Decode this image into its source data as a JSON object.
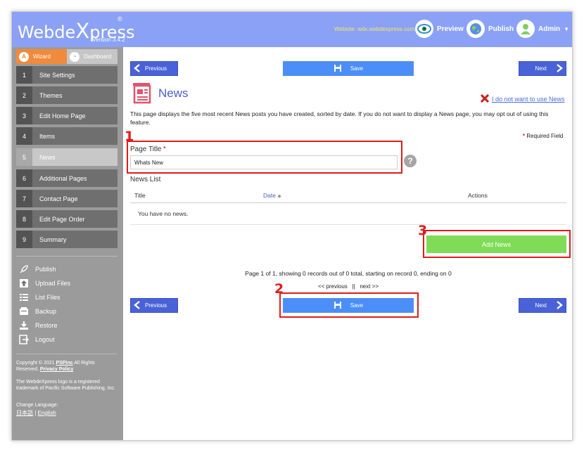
{
  "header": {
    "logo_part1": "Webde",
    "logo_x": "X",
    "logo_part2": "press",
    "logo_reg": "®",
    "version": "Version 3.4.2",
    "website": "Website: wdx.webdexpress.com",
    "preview": "Preview",
    "publish": "Publish",
    "admin": "Admin"
  },
  "sidebar": {
    "tab_wizard": "Wizard",
    "tab_dashboard": "Dashboard",
    "steps": [
      {
        "num": "1",
        "label": "Site Settings"
      },
      {
        "num": "2",
        "label": "Themes"
      },
      {
        "num": "3",
        "label": "Edit Home Page"
      },
      {
        "num": "4",
        "label": "Items"
      },
      {
        "num": "5",
        "label": "News"
      },
      {
        "num": "6",
        "label": "Additional Pages"
      },
      {
        "num": "7",
        "label": "Contact Page"
      },
      {
        "num": "8",
        "label": "Edit Page Order"
      },
      {
        "num": "9",
        "label": "Summary"
      }
    ],
    "tools": [
      "Publish",
      "Upload Files",
      "List Files",
      "Backup",
      "Restore",
      "Logout"
    ],
    "copyright_a": "Copyright © 2021 ",
    "copyright_link": "PSPinc",
    "copyright_b": " All Rights Reserved. ",
    "privacy": "Privacy Policy",
    "trademark": "The WebdeXpress logo is a registered trademark of Pacific Software Publishing, Inc.",
    "change_language": "Change Language:",
    "lang_jp": "日本語",
    "lang_sep": " | ",
    "lang_en": "English"
  },
  "main": {
    "previous": "Previous",
    "save": "Save",
    "next": "Next",
    "title": "News",
    "opt_out": "I do not want to use News",
    "description": "This page displays the five most recent News posts you have created, sorted by date. If you do not want to display a News page, you may opt out of using this feature.",
    "required_mark": "*",
    "required_text": " Required Field",
    "page_title_label": "Page Title",
    "page_title_value": "Whats New",
    "help": "?",
    "news_list": "News List",
    "col_title": "Title",
    "col_date": "Date",
    "col_actions": "Actions",
    "empty": "You have no news.",
    "add_news": "Add News",
    "page_info": "Page 1 of 1, showing 0 records out of 0 total, starting on record 0, ending on 0",
    "pager_prev": "<< previous",
    "pager_sep": "||",
    "pager_next": "next >>"
  },
  "annotations": [
    "1",
    "2",
    "3"
  ]
}
